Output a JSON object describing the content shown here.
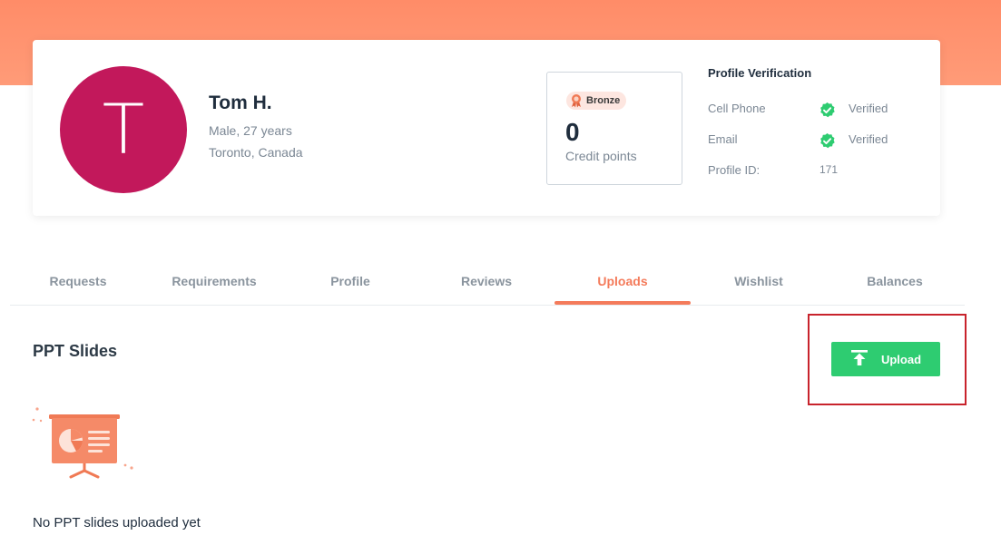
{
  "colors": {
    "brand": "#ff8c68",
    "accent": "#f47b5b",
    "success": "#2ecc71",
    "avatar": "#c2185b",
    "highlight": "#c8232c"
  },
  "profile": {
    "avatar_letter": "T",
    "name": "Tom H.",
    "gender_age": "Male, 27 years",
    "location": "Toronto, Canada"
  },
  "credits": {
    "badge_icon": "award-ribbon-icon",
    "badge": "Bronze",
    "value": "0",
    "label": "Credit points"
  },
  "verification": {
    "title": "Profile Verification",
    "rows": [
      {
        "label": "Cell Phone",
        "icon": "check-circle-icon",
        "status": "Verified"
      },
      {
        "label": "Email",
        "icon": "check-circle-icon",
        "status": "Verified"
      }
    ],
    "profile_id_label": "Profile ID:",
    "profile_id_value": "171"
  },
  "tabs": [
    {
      "label": "Requests"
    },
    {
      "label": "Requirements"
    },
    {
      "label": "Profile"
    },
    {
      "label": "Reviews"
    },
    {
      "label": "Uploads",
      "active": true
    },
    {
      "label": "Wishlist"
    },
    {
      "label": "Balances"
    }
  ],
  "uploads": {
    "section_title": "PPT Slides",
    "upload_icon": "upload-arrow-icon",
    "upload_label": "Upload",
    "empty_icon": "presentation-board-icon",
    "empty_text": "No PPT slides uploaded yet"
  }
}
